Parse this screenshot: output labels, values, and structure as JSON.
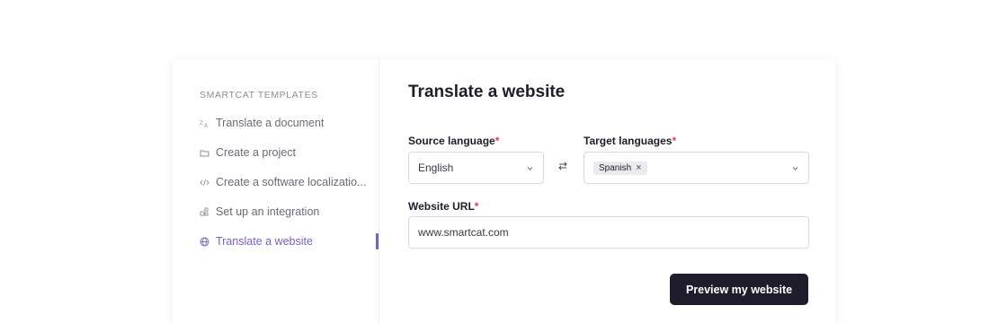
{
  "sidebar": {
    "heading": "SMARTCAT TEMPLATES",
    "items": [
      {
        "label": "Translate a document",
        "icon": "translate-icon",
        "active": false
      },
      {
        "label": "Create a project",
        "icon": "folder-icon",
        "active": false
      },
      {
        "label": "Create a software localizatio...",
        "icon": "code-icon",
        "active": false
      },
      {
        "label": "Set up an integration",
        "icon": "integration-icon",
        "active": false
      },
      {
        "label": "Translate a website",
        "icon": "globe-icon",
        "active": true
      }
    ]
  },
  "main": {
    "title": "Translate a website",
    "source_language": {
      "label": "Source language",
      "required_mark": "*",
      "value": "English"
    },
    "swap_icon": "swap-arrows-icon",
    "target_languages": {
      "label": "Target languages",
      "required_mark": "*",
      "tags": [
        "Spanish"
      ]
    },
    "website_url": {
      "label": "Website URL",
      "required_mark": "*",
      "value": "www.smartcat.com"
    },
    "preview_button": "Preview my website"
  },
  "colors": {
    "accent": "#7a5fc8",
    "required": "#e8384f",
    "primary_button": "#1f1d2b"
  }
}
